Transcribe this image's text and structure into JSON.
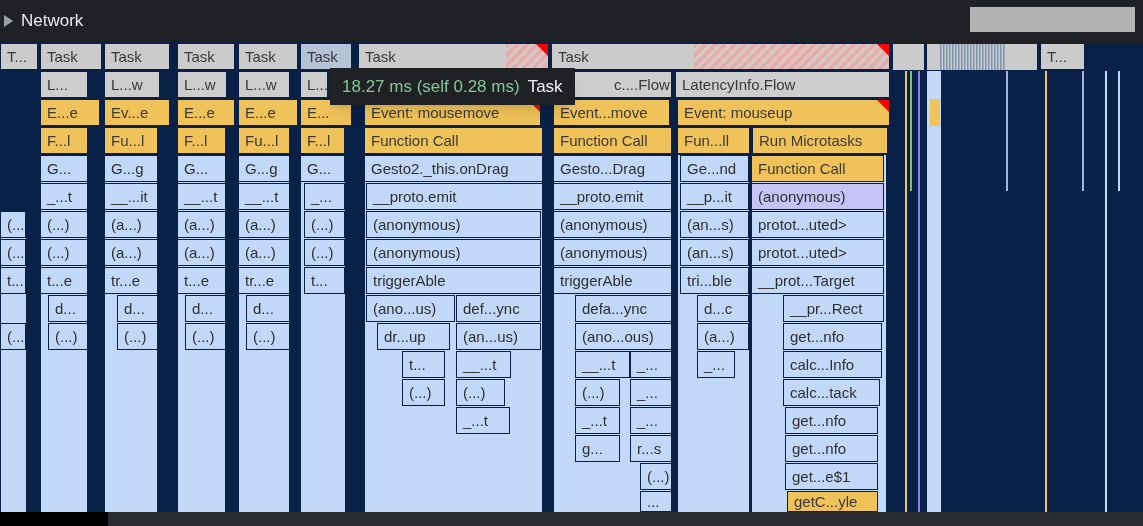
{
  "network_track": {
    "label": "Network",
    "expanded": false
  },
  "tooltip": {
    "duration": "18.27 ms (self 0.28 ms)",
    "name": "Task"
  },
  "flame_rows": [
    [
      {
        "label": "T...",
        "kind": "task",
        "selected": false,
        "flagged": false
      },
      {
        "label": "Task",
        "kind": "task",
        "selected": false,
        "flagged": false
      },
      {
        "label": "Task",
        "kind": "task",
        "selected": false,
        "flagged": false
      },
      {
        "label": "Task",
        "kind": "task",
        "selected": false,
        "flagged": false
      },
      {
        "label": "Task",
        "kind": "task",
        "selected": false,
        "flagged": false
      },
      {
        "label": "Task",
        "kind": "task",
        "selected": true,
        "flagged": false
      },
      {
        "label": "Task",
        "kind": "task",
        "selected": false,
        "flagged": true
      },
      {
        "label": "Task",
        "kind": "task",
        "selected": false,
        "flagged": true
      },
      {
        "label": "T...",
        "kind": "task",
        "selected": false,
        "flagged": false
      }
    ],
    [
      {
        "label": "L...",
        "kind": "other"
      },
      {
        "label": "L...w",
        "kind": "other"
      },
      {
        "label": "L...w",
        "kind": "other"
      },
      {
        "label": "L...w",
        "kind": "other"
      },
      {
        "label": "L...",
        "kind": "other"
      },
      {
        "label": "c....Flow",
        "kind": "other"
      },
      {
        "label": "LatencyInfo.Flow",
        "kind": "other"
      }
    ],
    [
      {
        "label": "E...e",
        "kind": "event",
        "flagged": false
      },
      {
        "label": "Ev...e",
        "kind": "event",
        "flagged": false
      },
      {
        "label": "E...e",
        "kind": "event",
        "flagged": false
      },
      {
        "label": "E...e",
        "kind": "event",
        "flagged": false
      },
      {
        "label": "E...",
        "kind": "event",
        "flagged": false
      },
      {
        "label": "Event: mousemove",
        "kind": "event",
        "flagged": true
      },
      {
        "label": "Event...move",
        "kind": "event",
        "flagged": false
      },
      {
        "label": "Event: mouseup",
        "kind": "event",
        "flagged": true
      }
    ],
    [
      {
        "label": "F...l",
        "kind": "script"
      },
      {
        "label": "Fu...l",
        "kind": "script"
      },
      {
        "label": "F...l",
        "kind": "script"
      },
      {
        "label": "Fu...l",
        "kind": "script"
      },
      {
        "label": "F...l",
        "kind": "script"
      },
      {
        "label": "Function Call",
        "kind": "script"
      },
      {
        "label": "Function Call",
        "kind": "script"
      },
      {
        "label": "Fun...ll",
        "kind": "script"
      },
      {
        "label": "Run Microtasks",
        "kind": "script"
      }
    ],
    [
      {
        "label": "G...",
        "kind": "js"
      },
      {
        "label": "G...g",
        "kind": "js"
      },
      {
        "label": "G...",
        "kind": "js"
      },
      {
        "label": "G...g",
        "kind": "js"
      },
      {
        "label": "G...",
        "kind": "js"
      },
      {
        "label": "Gesto2._this.onDrag",
        "kind": "js"
      },
      {
        "label": "Gesto...Drag",
        "kind": "js"
      },
      {
        "label": "Ge...nd",
        "kind": "js"
      },
      {
        "label": "Function Call",
        "kind": "script"
      }
    ],
    [
      {
        "label": "_...t",
        "kind": "js"
      },
      {
        "label": "__...it",
        "kind": "js"
      },
      {
        "label": "__...t",
        "kind": "js"
      },
      {
        "label": "__...t",
        "kind": "js"
      },
      {
        "label": "_...",
        "kind": "js"
      },
      {
        "label": "__proto.emit",
        "kind": "js"
      },
      {
        "label": "__proto.emit",
        "kind": "js"
      },
      {
        "label": "__p...it",
        "kind": "js"
      },
      {
        "label": "(anonymous)",
        "kind": "js-highlight"
      }
    ],
    [
      {
        "label": "(...",
        "kind": "js"
      },
      {
        "label": "(...)",
        "kind": "js"
      },
      {
        "label": "(a...)",
        "kind": "js"
      },
      {
        "label": "(a...)",
        "kind": "js"
      },
      {
        "label": "(a...)",
        "kind": "js"
      },
      {
        "label": "(...)",
        "kind": "js"
      },
      {
        "label": "(anonymous)",
        "kind": "js"
      },
      {
        "label": "(anonymous)",
        "kind": "js"
      },
      {
        "label": "(an...s)",
        "kind": "js"
      },
      {
        "label": "protot...uted>",
        "kind": "js"
      }
    ],
    [
      {
        "label": "(...",
        "kind": "js"
      },
      {
        "label": "(...)",
        "kind": "js"
      },
      {
        "label": "(a...)",
        "kind": "js"
      },
      {
        "label": "(a...)",
        "kind": "js"
      },
      {
        "label": "(a...)",
        "kind": "js"
      },
      {
        "label": "(...)",
        "kind": "js"
      },
      {
        "label": "(anonymous)",
        "kind": "js"
      },
      {
        "label": "(anonymous)",
        "kind": "js"
      },
      {
        "label": "(an...s)",
        "kind": "js"
      },
      {
        "label": "protot...uted>",
        "kind": "js"
      }
    ],
    [
      {
        "label": "t...",
        "kind": "js"
      },
      {
        "label": "t...e",
        "kind": "js"
      },
      {
        "label": "tr...e",
        "kind": "js"
      },
      {
        "label": "t...e",
        "kind": "js"
      },
      {
        "label": "tr...e",
        "kind": "js"
      },
      {
        "label": "t...",
        "kind": "js"
      },
      {
        "label": "triggerAble",
        "kind": "js"
      },
      {
        "label": "triggerAble",
        "kind": "js"
      },
      {
        "label": "tri...ble",
        "kind": "js"
      },
      {
        "label": "__prot...Target",
        "kind": "js"
      }
    ],
    [
      {
        "label": "d...",
        "kind": "js"
      },
      {
        "label": "d...",
        "kind": "js"
      },
      {
        "label": "d...",
        "kind": "js"
      },
      {
        "label": "d...",
        "kind": "js"
      },
      {
        "label": "(ano...us)",
        "kind": "js"
      },
      {
        "label": "def...ync",
        "kind": "js"
      },
      {
        "label": "defa...ync",
        "kind": "js"
      },
      {
        "label": "d...c",
        "kind": "js"
      },
      {
        "label": "__pr...Rect",
        "kind": "js"
      }
    ],
    [
      {
        "label": "(...",
        "kind": "js"
      },
      {
        "label": "(...)",
        "kind": "js"
      },
      {
        "label": "(...)",
        "kind": "js"
      },
      {
        "label": "(...)",
        "kind": "js"
      },
      {
        "label": "(...)",
        "kind": "js"
      },
      {
        "label": "dr...up",
        "kind": "js"
      },
      {
        "label": "(an...us)",
        "kind": "js"
      },
      {
        "label": "(ano...ous)",
        "kind": "js"
      },
      {
        "label": "(a...)",
        "kind": "js"
      },
      {
        "label": "get...nfo",
        "kind": "js"
      }
    ],
    [
      {
        "label": "t...",
        "kind": "js"
      },
      {
        "label": "__...t",
        "kind": "js"
      },
      {
        "label": "__...t",
        "kind": "js"
      },
      {
        "label": "_...",
        "kind": "js"
      },
      {
        "label": "_...",
        "kind": "js"
      },
      {
        "label": "calc...Info",
        "kind": "js"
      }
    ],
    [
      {
        "label": "(...)",
        "kind": "js"
      },
      {
        "label": "(...)",
        "kind": "js"
      },
      {
        "label": "(...)",
        "kind": "js"
      },
      {
        "label": "_...",
        "kind": "js"
      },
      {
        "label": "calc...tack",
        "kind": "js"
      }
    ],
    [
      {
        "label": "_...t",
        "kind": "js"
      },
      {
        "label": "_...t",
        "kind": "js"
      },
      {
        "label": "_...",
        "kind": "js"
      },
      {
        "label": "get...nfo",
        "kind": "js"
      }
    ],
    [
      {
        "label": "g...",
        "kind": "js"
      },
      {
        "label": "r...s",
        "kind": "js"
      },
      {
        "label": "get...nfo",
        "kind": "js"
      }
    ],
    [
      {
        "label": "(...)",
        "kind": "js"
      },
      {
        "label": "get...e$1",
        "kind": "js"
      }
    ],
    [
      {
        "label": "...",
        "kind": "js"
      },
      {
        "label": "getC...yle",
        "kind": "script"
      }
    ]
  ]
}
